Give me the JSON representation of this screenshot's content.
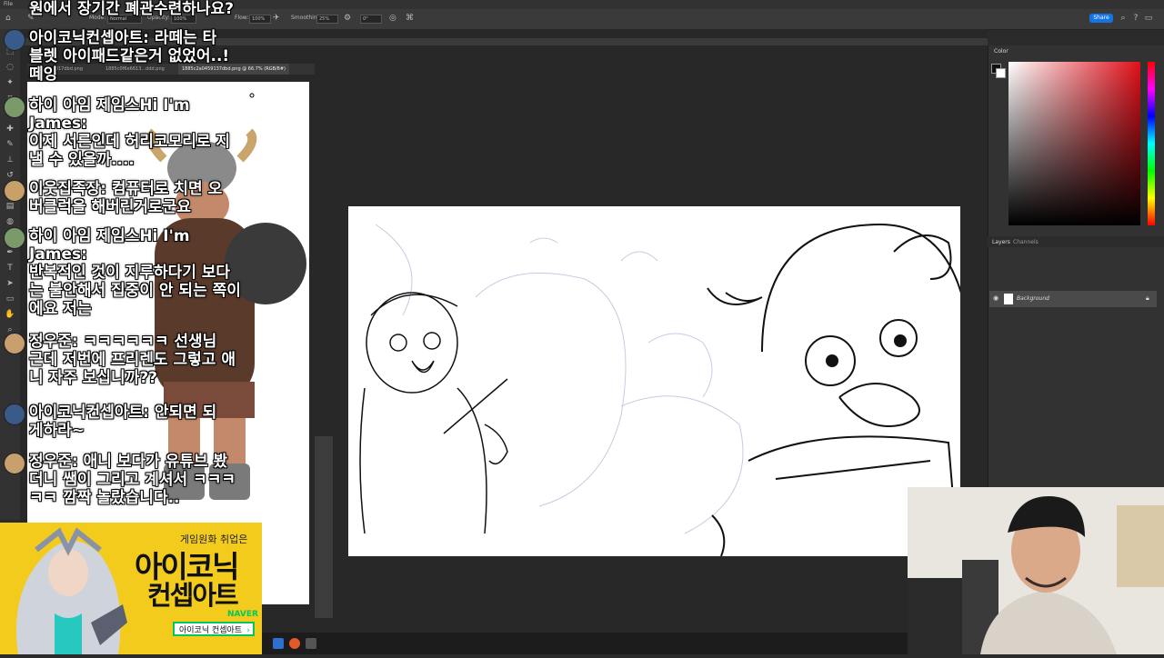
{
  "menubar": {
    "items": [
      "File"
    ]
  },
  "options": {
    "mode_label": "Mode:",
    "mode_value": "Normal",
    "opacity_label": "Opacity:",
    "opacity_value": "100%",
    "flow_label": "Flow:",
    "flow_value": "100%",
    "smoothing_label": "Smoothing:",
    "smoothing_value": "25%",
    "angle_value": "0°",
    "share_label": "Share"
  },
  "doc_tabs": [
    "1e97a1...4d17dbd.png",
    "1885c0f6e6613...ddd.png",
    "1885c2a0459137dbd.png @ 66.7% (RGB/8#)"
  ],
  "panels": {
    "color_tab": "Color",
    "layers_tab": "Layers",
    "channels_tab": "Channels",
    "layer_name": "Background"
  },
  "chat": [
    {
      "text": "원에서 장기간 폐관수련하나요?",
      "avatar_color": ""
    },
    {
      "text": "아이코닉컨셉아트: 라떼는 타\n블렛 아이패드같은거 없었어..!\n떼잉",
      "avatar_color": "#3a5a8a"
    },
    {
      "text": "하이 아임 제임스Hi I'm\nJames:\n이제 서른인데 허리코모리로 지\n낼 수 있을까....",
      "avatar_color": "#7a9a6a"
    },
    {
      "text": "이웃집족장: 컴퓨터로 치면 오\n버클럭을 해버린거로군요",
      "avatar_color": "#c8a06a"
    },
    {
      "text": "하이 아임 제임스Hi I'm\nJames:\n반복적인 것이 지루하다기 보다\n는 불안해서 집중이 안 되는 쪽이\n에요 저는",
      "avatar_color": "#7a9a6a"
    },
    {
      "text": "정우준: ㅋㅋㅋㅋㅋㅋ 선생님\n근데 저번에 프리렌도 그렇고 애\n니 자주 보십니까??",
      "avatar_color": "#c8a070"
    },
    {
      "text": "아이코닉컨셉아트: 안되면 되\n게하라~",
      "avatar_color": "#3a5a8a"
    },
    {
      "text": "정우준: 애니 보다가 유튜브 봤\n더니 쌤이 그리고 계셔서 ㅋㅋㅋ\nㅋㅋ 깜짝 놀랐습니다..",
      "avatar_color": "#c8a070"
    }
  ],
  "banner": {
    "tagline": "게임원화 취업은",
    "title_line1": "아이코닉",
    "title_line2": "컨셉아트",
    "naver": "NAVER",
    "search_text": "아이코닉 컨셉아트"
  },
  "colors": {
    "accent": "#1473e6",
    "banner_yellow": "#f3cb1d",
    "naver_green": "#03c75a"
  }
}
